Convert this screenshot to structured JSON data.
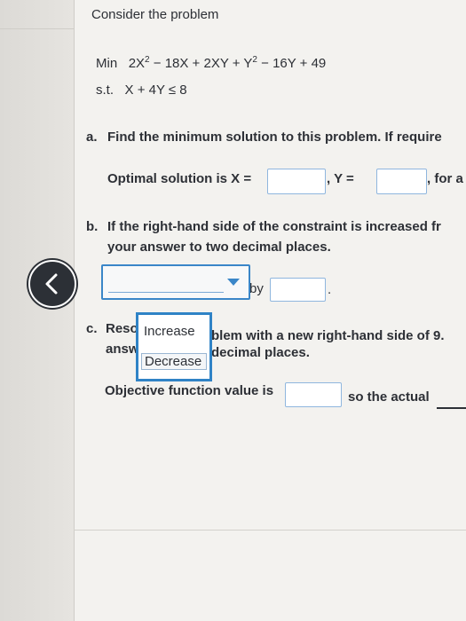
{
  "intro": "Consider the problem",
  "objective": {
    "prefix": "Min",
    "t1": "2X",
    "t1_exp": "2",
    "t2": " − 18X + 2XY + Y",
    "t2_exp": "2",
    "t3": " − 16Y + 49"
  },
  "constraint": {
    "prefix": "s.t.",
    "expr": "X + 4Y ≤ 8"
  },
  "part_a": {
    "letter": "a.",
    "question": "Find the minimum solution to this problem. If require",
    "solution_label": "Optimal solution is X =",
    "y_label": ", Y =",
    "tail": ", for a",
    "x_value": "",
    "y_value": ""
  },
  "part_b": {
    "letter": "b.",
    "line1": "If the right-hand side of the constraint is increased fr",
    "line2": "your answer to two decimal places.",
    "select_value": "",
    "by_label": "by",
    "by_value": "",
    "period": "."
  },
  "dropdown": {
    "options": [
      "Increase",
      "Decrease"
    ]
  },
  "part_c": {
    "letter": "c.",
    "line1_a": "Reso",
    "line1_b": "blem with a new right-hand side of 9.",
    "line2_a": "answ",
    "line2_b": "decimal places.",
    "obj_label": "Objective function value is",
    "obj_value": "",
    "tail": "so the actual"
  },
  "nav": {
    "back_icon": "chevron-left-icon"
  }
}
